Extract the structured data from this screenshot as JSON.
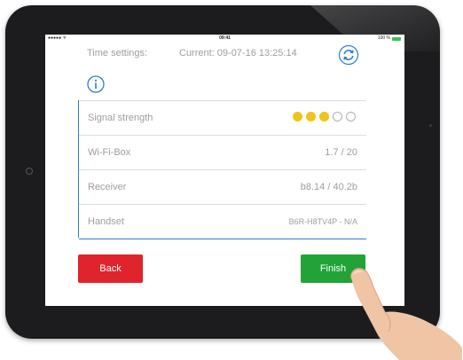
{
  "status_bar": {
    "carrier": "●●●●● ᯤ",
    "time": "09:41",
    "battery_text": "100 %"
  },
  "time_settings": {
    "label": "Time settings:",
    "current": "Current: 09-07-16 13:25:14",
    "sync_icon": "sync-icon"
  },
  "info_icon": "info-icon",
  "info_rows": [
    {
      "key": "Signal strength",
      "type": "signal",
      "filled": 3,
      "total": 5
    },
    {
      "key": "Wi-Fi-Box",
      "value": "1.7 / 20"
    },
    {
      "key": "Receiver",
      "value": "b8.14 / 40.2b"
    },
    {
      "key": "Handset",
      "value": "B6R-H8TV4P - N/A"
    }
  ],
  "buttons": {
    "back": "Back",
    "finish": "Finish"
  },
  "colors": {
    "accent": "#2f7bd0",
    "back": "#e0242b",
    "finish": "#21a338",
    "signal_on": "#f0c418"
  }
}
